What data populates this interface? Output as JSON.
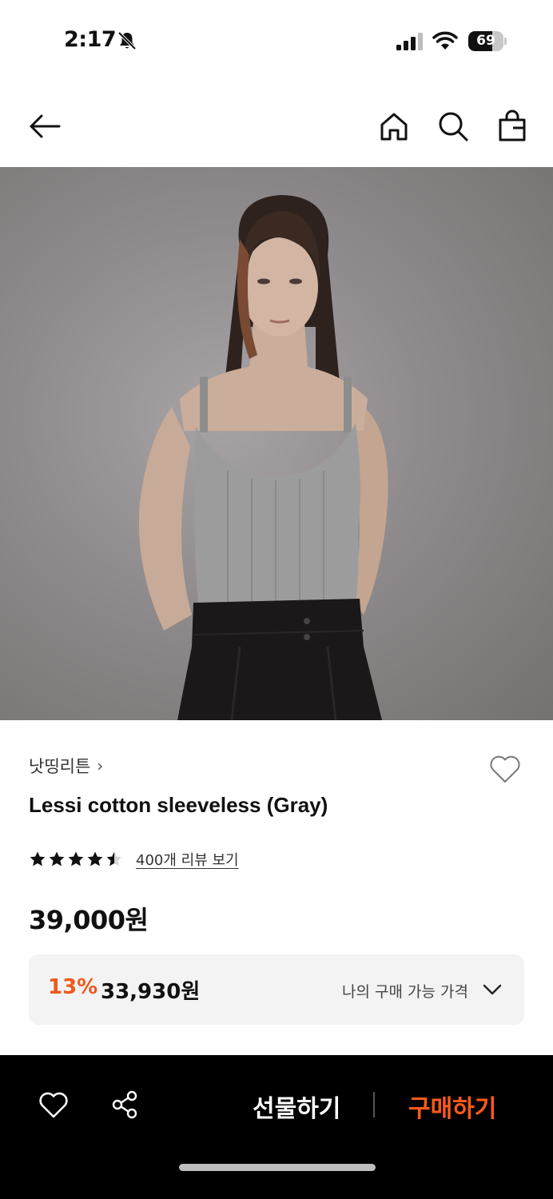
{
  "status_bar": {
    "time": "2:17",
    "battery_level": "69",
    "icons": [
      "bell-slash-icon",
      "signal-icon",
      "wifi-icon",
      "battery-icon"
    ]
  },
  "nav": {
    "icons": [
      "back-arrow-icon",
      "home-icon",
      "search-icon",
      "shopping-bag-icon"
    ]
  },
  "product": {
    "image_icon": "product-photo",
    "brand": "낫띵리튼",
    "brand_chevron": "›",
    "name": "Lessi cotton sleeveless (Gray)",
    "rating": 4.5,
    "rating_max": 5,
    "review_link": "400개 리뷰 보기",
    "price": "39,000원"
  },
  "discount": {
    "percent": "13%",
    "price": "33,930원",
    "my_price_label": "나의 구매 가능 가격"
  },
  "bottom_bar": {
    "gift_label": "선물하기",
    "buy_label": "구매하기",
    "icons": [
      "heart-icon",
      "share-icon"
    ]
  },
  "colors": {
    "accent": "#ee5a1d",
    "buy_accent": "#ff5a1a",
    "bottom_bar_bg": "#000000",
    "discount_bg": "#f3f3f3"
  }
}
